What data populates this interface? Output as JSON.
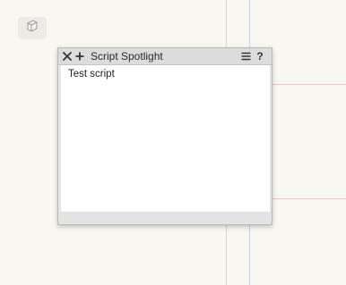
{
  "palette": {
    "title": "Script Spotlight",
    "help_label": "?",
    "items": [
      {
        "label": "Test script"
      }
    ]
  },
  "icons": {
    "close": "close-icon",
    "add": "plus-icon",
    "menu": "hamburger-menu-icon",
    "document": "document-icon"
  }
}
